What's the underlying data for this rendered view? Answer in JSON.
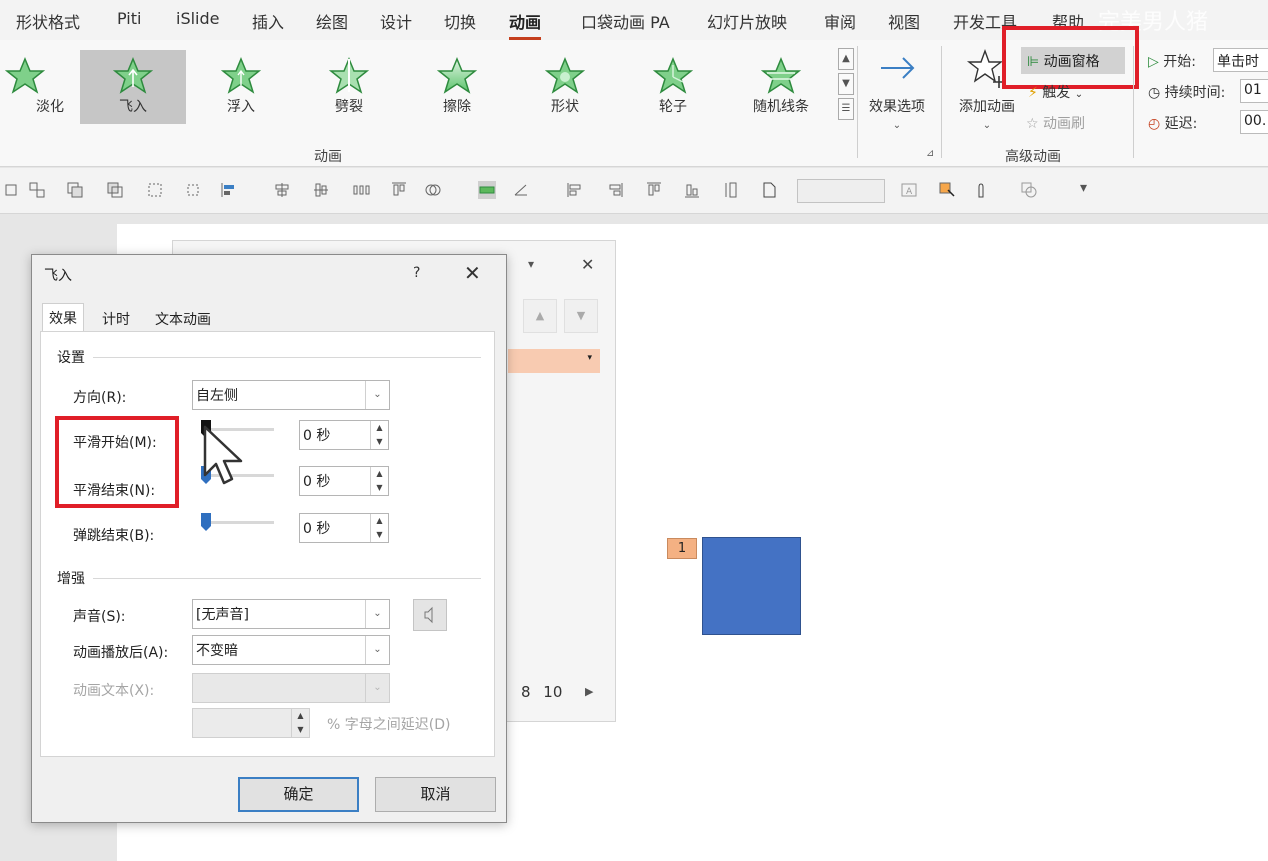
{
  "ribbon_tabs": [
    "形状格式",
    "Piti",
    "iSlide",
    "插入",
    "绘图",
    "设计",
    "切换",
    "动画",
    "口袋动画 PA",
    "幻灯片放映",
    "审阅",
    "视图",
    "开发工具",
    "帮助"
  ],
  "watermark_text": "完美男人猪",
  "gallery": [
    {
      "label": "淡化",
      "icon": "fade-star-icon"
    },
    {
      "label": "飞入",
      "icon": "fly-in-star-icon"
    },
    {
      "label": "浮入",
      "icon": "float-in-star-icon"
    },
    {
      "label": "劈裂",
      "icon": "split-star-icon"
    },
    {
      "label": "擦除",
      "icon": "wipe-star-icon"
    },
    {
      "label": "形状",
      "icon": "shape-star-icon"
    },
    {
      "label": "轮子",
      "icon": "wheel-star-icon"
    },
    {
      "label": "随机线条",
      "icon": "random-bars-star-icon"
    }
  ],
  "group_animation": "动画",
  "effect_options": "效果选项",
  "add_animation": "添加动画",
  "animation_pane": "动画窗格",
  "trigger": "触发",
  "animation_painter": "动画刷",
  "group_advanced": "高级动画",
  "timing": {
    "start_label": "开始:",
    "start_value": "单击时",
    "duration_label": "持续时间:",
    "duration_value": "01",
    "delay_label": "延迟:",
    "delay_value": "00."
  },
  "slide": {
    "badge": "1",
    "shape_color": "#4472c4"
  },
  "pane_pager": "8  10",
  "dialog": {
    "title": "飞入",
    "help": "?",
    "tabs": [
      "效果",
      "计时",
      "文本动画"
    ],
    "settings_header": "设置",
    "direction_label": "方向(R):",
    "direction_value": "自左侧",
    "smooth_start_label": "平滑开始(M):",
    "smooth_start_value": "0 秒",
    "smooth_end_label": "平滑结束(N):",
    "smooth_end_value": "0 秒",
    "bounce_end_label": "弹跳结束(B):",
    "bounce_end_value": "0 秒",
    "enhance_header": "增强",
    "sound_label": "声音(S):",
    "sound_value": "[无声音]",
    "after_anim_label": "动画播放后(A):",
    "after_anim_value": "不变暗",
    "anim_text_label": "动画文本(X):",
    "anim_text_value": "",
    "delay_between_letters": "% 字母之间延迟(D)",
    "ok": "确定",
    "cancel": "取消"
  },
  "colors": {
    "highlight_red": "#e01e28",
    "accent_tab": "#c43e1c",
    "selection_blue": "#3b7fc4"
  }
}
